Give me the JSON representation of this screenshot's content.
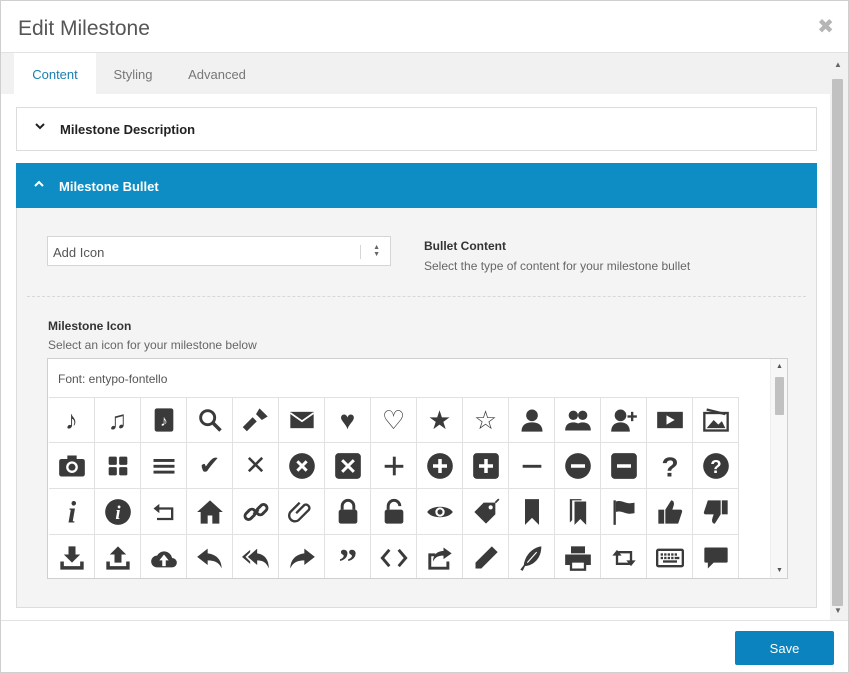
{
  "dialog": {
    "title": "Edit Milestone",
    "close_glyph": "✖",
    "close_icon": "close-icon"
  },
  "tabs": [
    {
      "label": "Content",
      "active": true
    },
    {
      "label": "Styling",
      "active": false
    },
    {
      "label": "Advanced",
      "active": false
    }
  ],
  "sections": {
    "description": {
      "title": "Milestone Description",
      "expanded": false
    },
    "bullet": {
      "title": "Milestone Bullet",
      "expanded": true
    }
  },
  "bullet_content": {
    "select_value": "Add Icon",
    "label": "Bullet Content",
    "help": "Select the type of content for your milestone bullet"
  },
  "milestone_icon": {
    "label": "Milestone Icon",
    "help": "Select an icon for your milestone below",
    "font_label": "Font: entypo-fontello",
    "icons": [
      "note-icon",
      "music-icon",
      "music-doc-icon",
      "search-icon",
      "flashlight-icon",
      "mail-icon",
      "heart-icon",
      "heart-empty-icon",
      "star-icon",
      "star-empty-icon",
      "user-icon",
      "users-icon",
      "user-add-icon",
      "video-icon",
      "picture-icon",
      "camera-icon",
      "th-large-icon",
      "menu-icon",
      "check-icon",
      "cancel-icon",
      "cancel-circled-icon",
      "cancel-squared-icon",
      "plus-icon",
      "plus-circled-icon",
      "plus-squared-icon",
      "minus-icon",
      "minus-circled-icon",
      "minus-squared-icon",
      "help-icon",
      "help-circled-icon",
      "info-icon",
      "info-circled-icon",
      "back-icon",
      "home-icon",
      "link-icon",
      "attach-icon",
      "lock-icon",
      "lock-open-icon",
      "eye-icon",
      "tag-icon",
      "bookmark-icon",
      "bookmarks-icon",
      "flag-icon",
      "thumbs-up-icon",
      "thumbs-down-icon",
      "download-icon",
      "upload-icon",
      "upload-cloud-icon",
      "reply-icon",
      "reply-all-icon",
      "forward-icon",
      "quote-icon",
      "code-icon",
      "export-icon",
      "pencil-icon",
      "feather-icon",
      "print-icon",
      "retweet-icon",
      "keyboard-icon",
      "comment-icon"
    ]
  },
  "footer": {
    "save_label": "Save"
  },
  "colors": {
    "accent": "#0d8dc4",
    "save": "#0b83bf",
    "tab_active_text": "#1a7fb0"
  }
}
